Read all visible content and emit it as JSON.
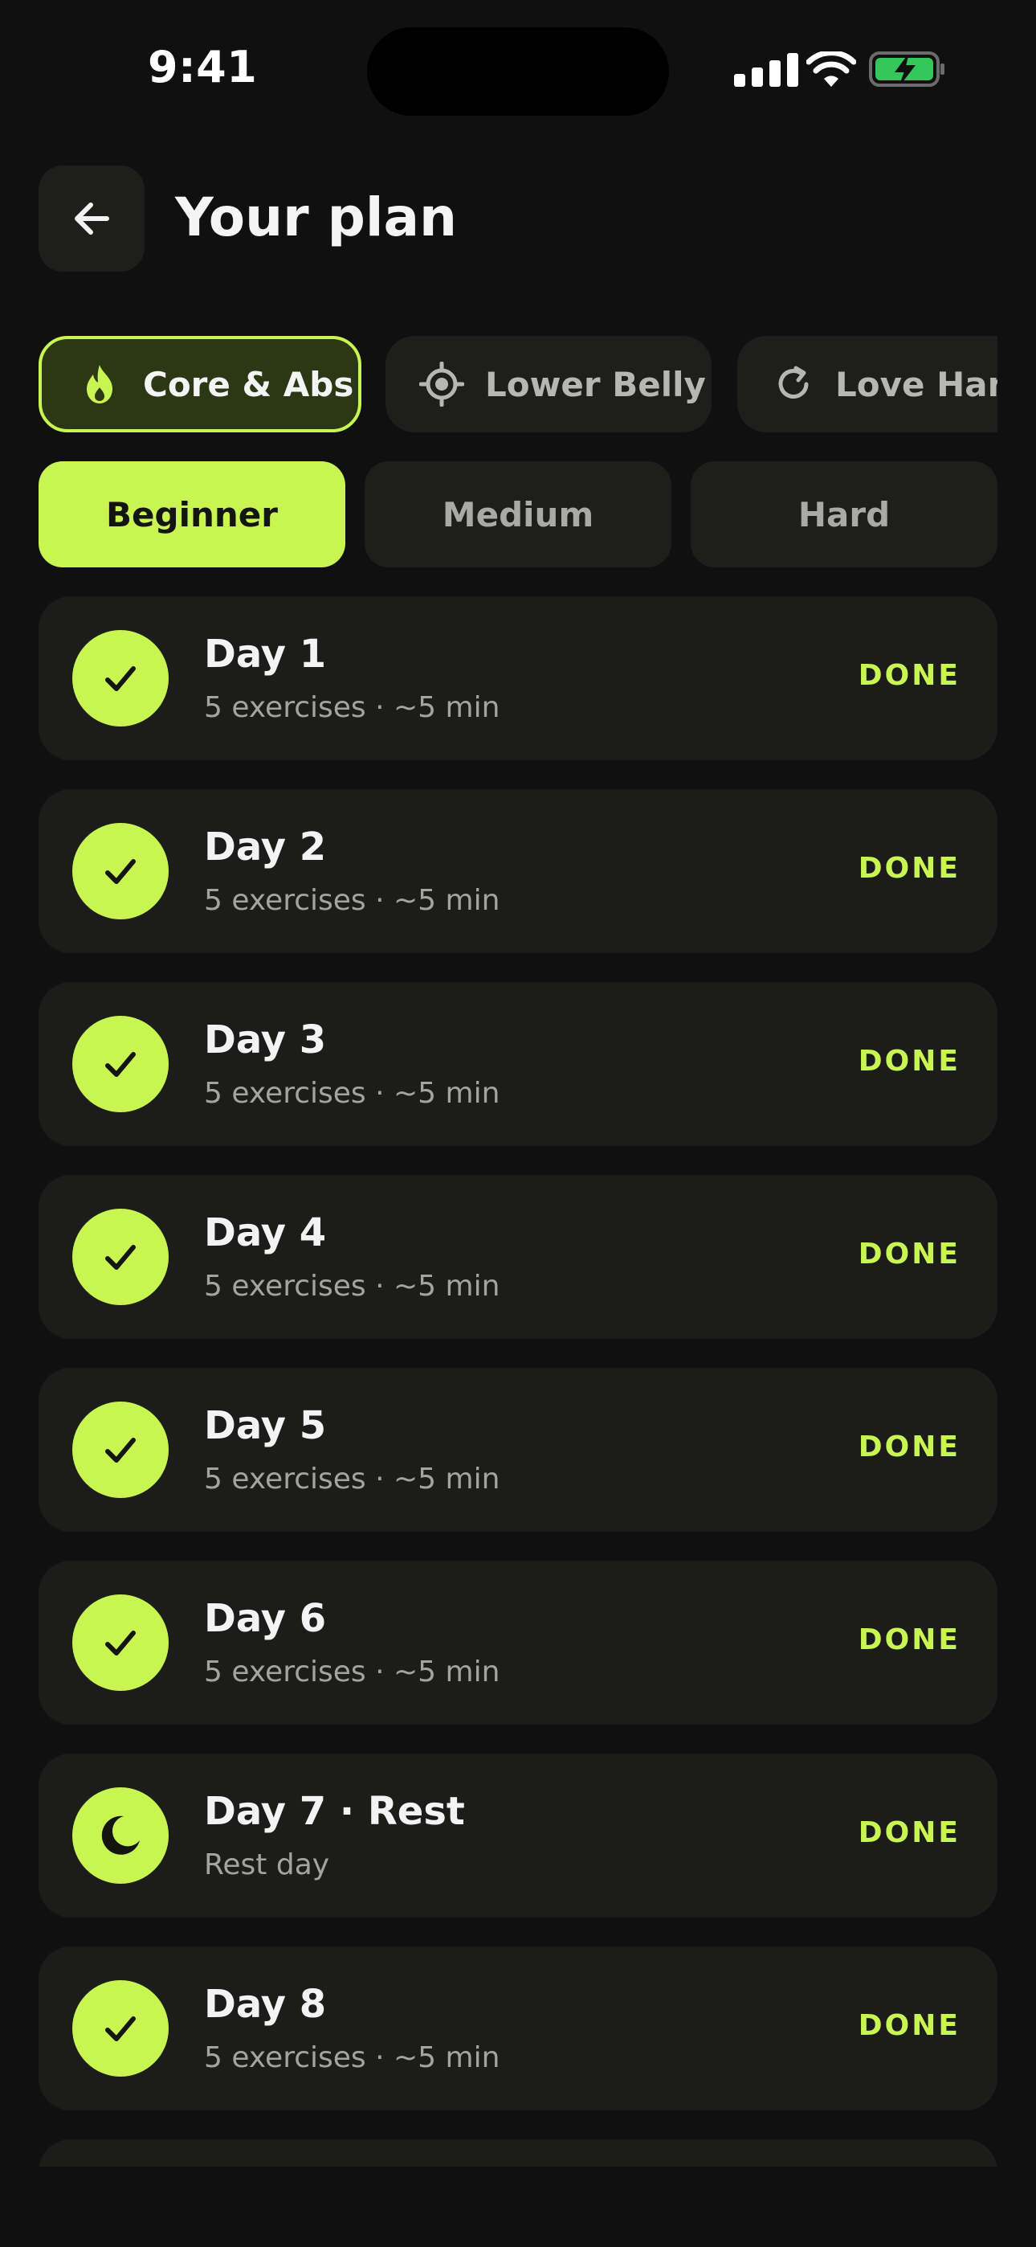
{
  "status_bar": {
    "time": "9:41"
  },
  "header": {
    "title": "Your plan"
  },
  "categories": [
    {
      "label": "Core & Abs",
      "icon": "flame-icon",
      "active": true
    },
    {
      "label": "Lower Belly",
      "icon": "target-icon",
      "active": false
    },
    {
      "label": "Love Handles",
      "icon": "refresh-icon",
      "active": false
    }
  ],
  "levels": [
    {
      "label": "Beginner",
      "active": true
    },
    {
      "label": "Medium",
      "active": false
    },
    {
      "label": "Hard",
      "active": false
    }
  ],
  "days": [
    {
      "title": "Day 1",
      "subtitle": "5 exercises · ~5 min",
      "status": "DONE",
      "icon": "check-icon"
    },
    {
      "title": "Day 2",
      "subtitle": "5 exercises · ~5 min",
      "status": "DONE",
      "icon": "check-icon"
    },
    {
      "title": "Day 3",
      "subtitle": "5 exercises · ~5 min",
      "status": "DONE",
      "icon": "check-icon"
    },
    {
      "title": "Day 4",
      "subtitle": "5 exercises · ~5 min",
      "status": "DONE",
      "icon": "check-icon"
    },
    {
      "title": "Day 5",
      "subtitle": "5 exercises · ~5 min",
      "status": "DONE",
      "icon": "check-icon"
    },
    {
      "title": "Day 6",
      "subtitle": "5 exercises · ~5 min",
      "status": "DONE",
      "icon": "check-icon"
    },
    {
      "title": "Day 7 · Rest",
      "subtitle": "Rest day",
      "status": "DONE",
      "icon": "moon-icon"
    },
    {
      "title": "Day 8",
      "subtitle": "5 exercises · ~5 min",
      "status": "DONE",
      "icon": "check-icon"
    }
  ],
  "colors": {
    "accent": "#c9f552",
    "background": "#0f100f",
    "card": "#1c1d1b",
    "chip_active_bg": "#2c3813"
  }
}
